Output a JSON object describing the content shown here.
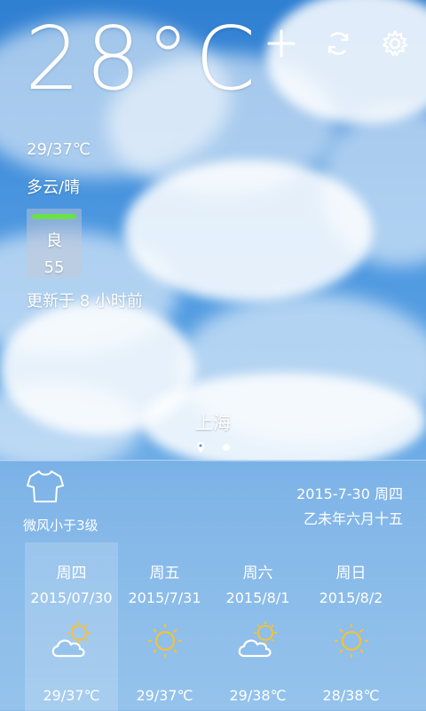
{
  "current": {
    "temperature": "28°C",
    "range": "29/37℃",
    "condition": "多云/晴",
    "aqi_level": "良",
    "aqi_value": "55",
    "updated": "更新于 8 小时前",
    "aqi_color": "#6be04a"
  },
  "toolbar": {
    "add_icon": "plus-icon",
    "refresh_icon": "refresh-icon",
    "settings_icon": "gear-icon"
  },
  "location": {
    "city": "上海",
    "pages": 2
  },
  "bottom": {
    "clothing_icon": "shirt-icon",
    "wind": "微风小于3级",
    "date": "2015-7-30 周四",
    "lunar": "乙未年六月十五"
  },
  "forecast": [
    {
      "day": "周四",
      "date": "2015/07/30",
      "icon": "cloud-sun-icon",
      "range": "29/37℃"
    },
    {
      "day": "周五",
      "date": "2015/7/31",
      "icon": "sun-icon",
      "range": "29/37℃"
    },
    {
      "day": "周六",
      "date": "2015/8/1",
      "icon": "cloud-sun-icon",
      "range": "29/38℃"
    },
    {
      "day": "周日",
      "date": "2015/8/2",
      "icon": "sun-icon",
      "range": "28/38℃"
    }
  ]
}
